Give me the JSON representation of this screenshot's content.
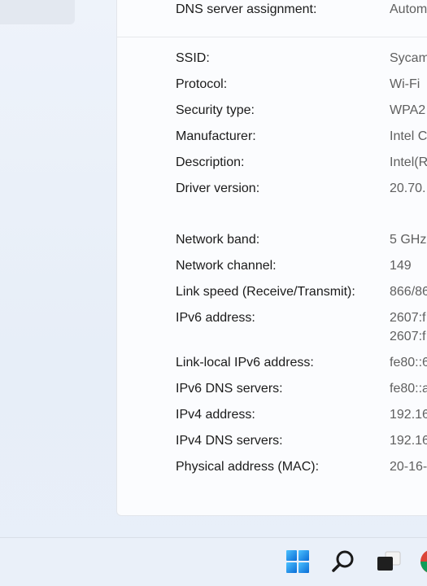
{
  "dns_row": {
    "label": "DNS server assignment:",
    "value": "Autom"
  },
  "details": [
    {
      "label": "SSID:",
      "value": "Sycam"
    },
    {
      "label": "Protocol:",
      "value": "Wi-Fi"
    },
    {
      "label": "Security type:",
      "value": "WPA2"
    },
    {
      "label": "Manufacturer:",
      "value": "Intel C"
    },
    {
      "label": "Description:",
      "value": "Intel(R"
    },
    {
      "label": "Driver version:",
      "value": "20.70."
    },
    {
      "label": "Network band:",
      "value": "5 GHz"
    },
    {
      "label": "Network channel:",
      "value": "149"
    },
    {
      "label": "Link speed (Receive/Transmit):",
      "value": "866/86"
    },
    {
      "label": "IPv6 address:",
      "value": "2607:f",
      "value2": "2607:f"
    },
    {
      "label": "Link-local IPv6 address:",
      "value": "fe80::6"
    },
    {
      "label": "IPv6 DNS servers:",
      "value": "fe80::a"
    },
    {
      "label": "IPv4 address:",
      "value": "192.16"
    },
    {
      "label": "IPv4 DNS servers:",
      "value": "192.16"
    },
    {
      "label": "Physical address (MAC):",
      "value": "20-16-"
    }
  ],
  "taskbar": {
    "icons": [
      "windows-start-icon",
      "search-icon",
      "task-view-icon",
      "chrome-icon"
    ],
    "colors": {
      "start_light": "#4cc2ff",
      "start_dark": "#0a6cd6"
    }
  }
}
